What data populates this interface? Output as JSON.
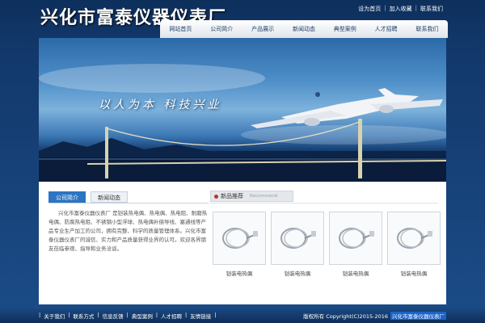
{
  "header": {
    "logo": "兴化市富泰仪器仪表厂",
    "links": [
      "设为首页",
      "加入收藏",
      "联系我们"
    ]
  },
  "nav": [
    "网站首页",
    "公司简介",
    "产品展示",
    "新闻动态",
    "典型案例",
    "人才招聘",
    "联系我们"
  ],
  "banner": {
    "slogan": "以人为本 科技兴业"
  },
  "about": {
    "tabs": [
      "公司简介",
      "新闻动态"
    ],
    "text": "兴化市富泰仪器仪表厂 是铠装热电偶、热电偶、热电阻、耐磨热电偶、防腐热电阻、不锈钢小型浮球、热电偶补偿导线、塞通线等产品专业生产加工的公司，拥有完整、科学的质量管理体系。兴化市富泰仪器仪表厂的诚信、实力和产品质量获得业界的认可。欢迎各界朋友莅临参观、指导和业务洽谈。"
  },
  "products": {
    "title": "新品推荐",
    "title_en": "Recommend",
    "items": [
      {
        "name": "铠装电热偶"
      },
      {
        "name": "铠装电热偶"
      },
      {
        "name": "铠装电热偶"
      },
      {
        "name": "铠装电热偶"
      }
    ]
  },
  "footer": {
    "links": [
      "关于我们",
      "联系方式",
      "信息反馈",
      "典型案例",
      "人才招聘",
      "友情链接"
    ],
    "copyright": "版权所有 Copyright(C)2015-2016",
    "company": "兴化市富泰仪器仪表厂"
  },
  "colors": {
    "accent": "#2b75c2",
    "background": "#12386b"
  },
  "icons": {
    "product": "coiled-cable-thumbnail",
    "bullet": "red-dot-icon"
  }
}
